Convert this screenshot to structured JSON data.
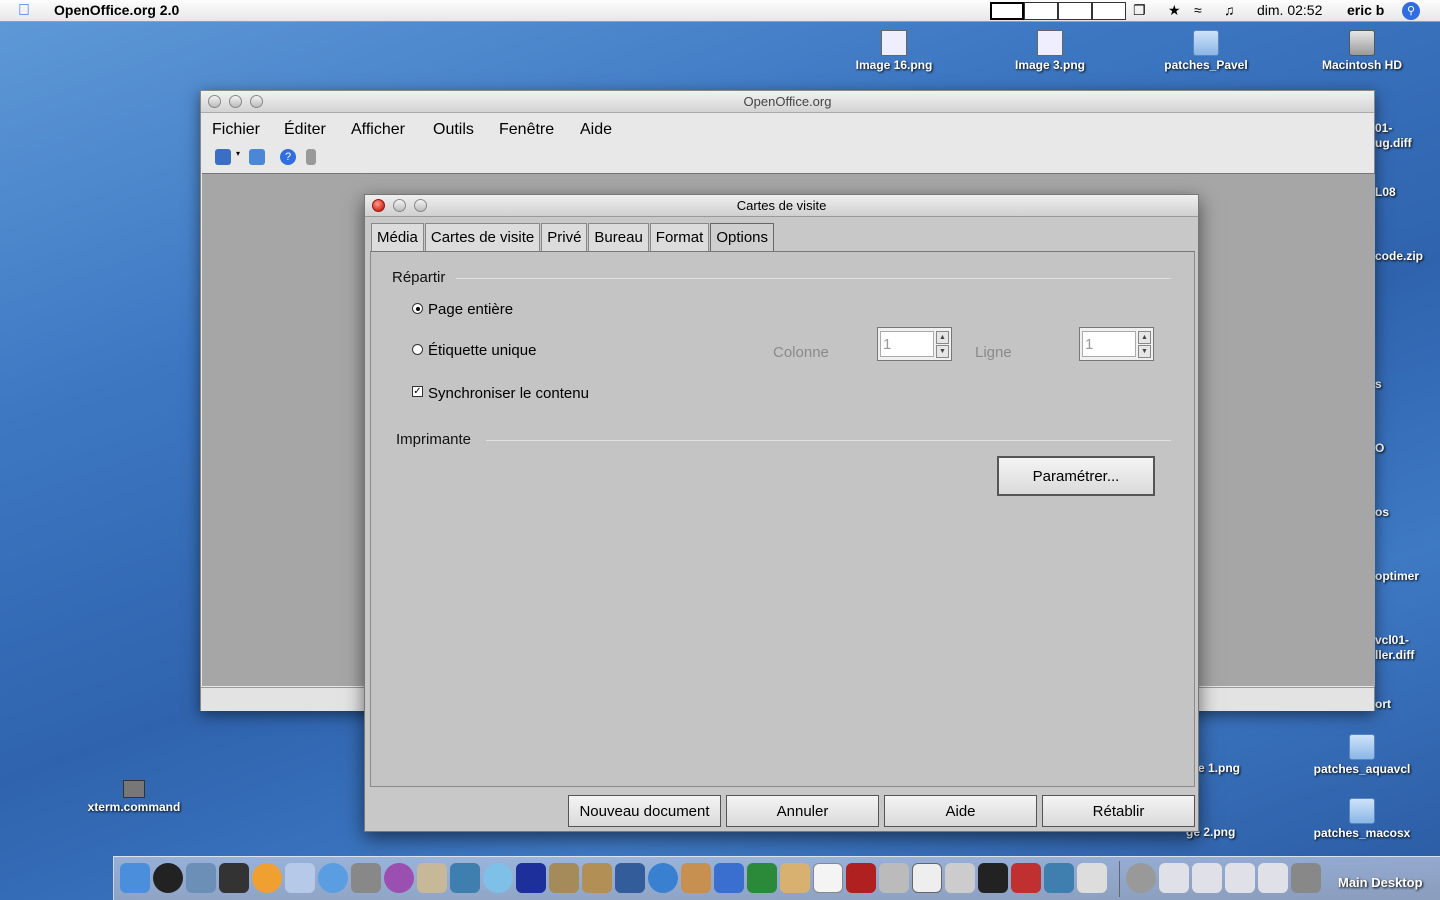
{
  "menubar": {
    "app_name": "OpenOffice.org 2.0",
    "clock": "dim. 02:52",
    "user": "eric b"
  },
  "desktop": {
    "icons": [
      {
        "label": "Image 16.png",
        "kind": "file"
      },
      {
        "label": "Image 3.png",
        "kind": "file"
      },
      {
        "label": "patches_Pavel",
        "kind": "folder"
      },
      {
        "label": "Macintosh HD",
        "kind": "disk"
      },
      {
        "label": "xterm.command",
        "kind": "terminal"
      },
      {
        "label": "patches_aquavcl",
        "kind": "folder"
      },
      {
        "label": "patches_macosx",
        "kind": "folder"
      }
    ],
    "partial_labels": [
      "01-",
      "ug.diff",
      "L08",
      "code.zip",
      "s",
      "O",
      "os",
      "optimer",
      "vcl01-",
      "ller.diff",
      "ort",
      "e 1.png",
      "ge 2.png"
    ]
  },
  "oo_window": {
    "title": "OpenOffice.org",
    "menu": [
      "Fichier",
      "Éditer",
      "Afficher",
      "Outils",
      "Fenêtre",
      "Aide"
    ]
  },
  "dialog": {
    "title": "Cartes de visite",
    "tabs": [
      "Média",
      "Cartes de visite",
      "Privé",
      "Bureau",
      "Format",
      "Options"
    ],
    "active_tab": "Options",
    "repartir": {
      "label": "Répartir",
      "page_entiere": "Page entière",
      "etiquette_unique": "Étiquette unique",
      "colonne_label": "Colonne",
      "colonne_value": "1",
      "ligne_label": "Ligne",
      "ligne_value": "1",
      "synchroniser": "Synchroniser le contenu"
    },
    "imprimante": {
      "label": "Imprimante",
      "parametrer": "Paramétrer..."
    },
    "buttons": {
      "nouveau": "Nouveau document",
      "annuler": "Annuler",
      "aide": "Aide",
      "retablir": "Rétablir"
    }
  },
  "dock": {
    "label": "Main Desktop"
  }
}
